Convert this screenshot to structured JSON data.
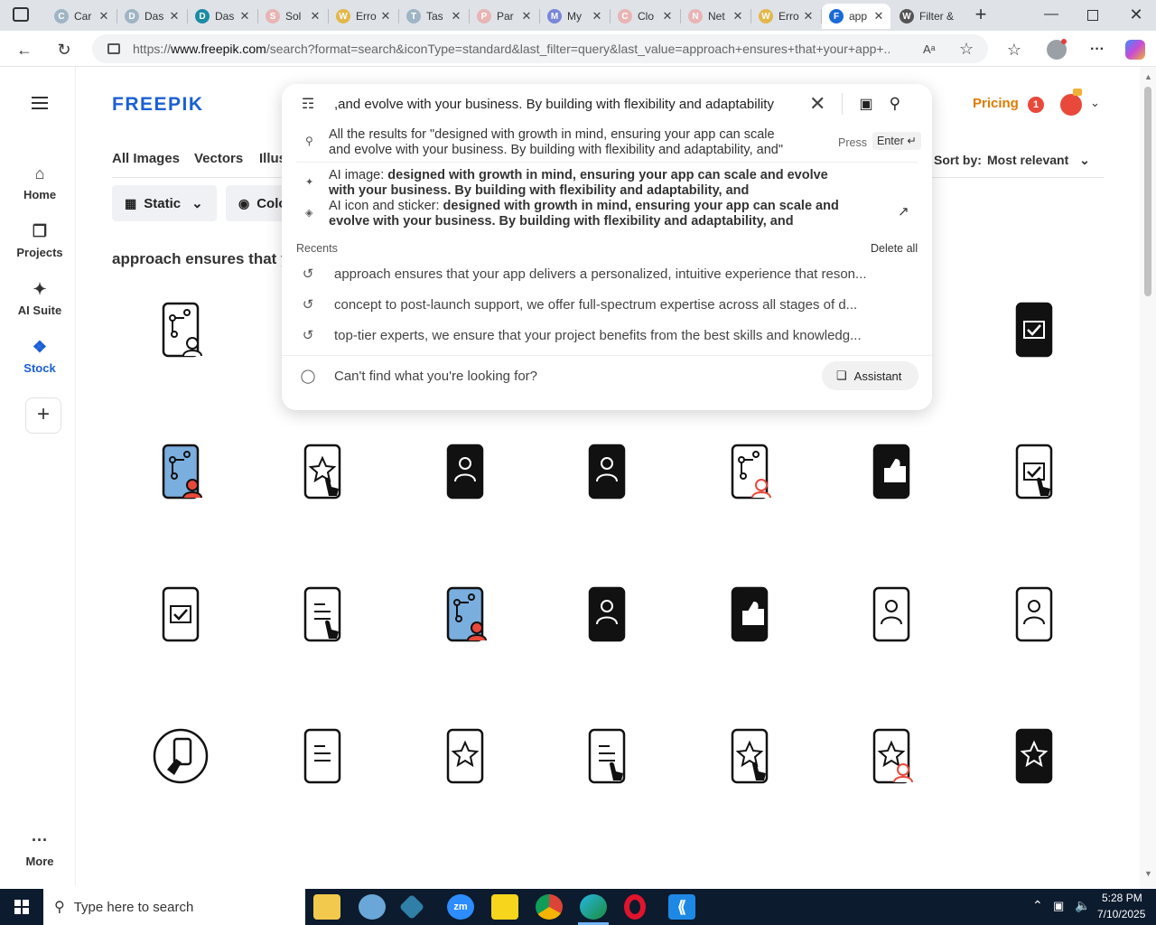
{
  "browser": {
    "tabs": [
      {
        "label": "Car",
        "color": "#9fb4c4",
        "letter": "C"
      },
      {
        "label": "Das",
        "color": "#9fb4c4",
        "letter": "D"
      },
      {
        "label": "Das",
        "color": "#1c8ba6",
        "letter": "D"
      },
      {
        "label": "Sol",
        "color": "#e8b4b4",
        "letter": "S"
      },
      {
        "label": "Erro",
        "color": "#e4b74a",
        "letter": "W"
      },
      {
        "label": "Tas",
        "color": "#9fb4c4",
        "letter": "T"
      },
      {
        "label": "Par",
        "color": "#e8b4b4",
        "letter": "P"
      },
      {
        "label": "My",
        "color": "#7a86d8",
        "letter": "M"
      },
      {
        "label": "Clo",
        "color": "#e8b4b4",
        "letter": "C"
      },
      {
        "label": "Net",
        "color": "#e8b4b4",
        "letter": "N"
      },
      {
        "label": "Erro",
        "color": "#e4b74a",
        "letter": "W"
      },
      {
        "label": "app",
        "color": "#1a6bd8",
        "letter": "F"
      },
      {
        "label": "Filter &",
        "color": "#555555",
        "letter": "W"
      }
    ],
    "url_prefix": "https://",
    "url_domain": "www.freepik.com",
    "url_rest": "/search?format=search&iconType=standard&last_filter=query&last_value=approach+ensures+that+your+app+..."
  },
  "sidebar": {
    "items": [
      {
        "label": "Home",
        "icon": "home-icon"
      },
      {
        "label": "Projects",
        "icon": "projects-icon"
      },
      {
        "label": "AI Suite",
        "icon": "ai-suite-icon"
      },
      {
        "label": "Stock",
        "icon": "stock-icon"
      }
    ],
    "more_label": "More"
  },
  "header": {
    "logo": "FREEPIK",
    "pricing": "Pricing",
    "notification_count": "1"
  },
  "search": {
    "value": "and evolve with your business. By building with flexibility and adaptability,",
    "all_results_line1": "All the results for \"designed with growth in mind, ensuring your app can scale",
    "all_results_line2": "and evolve with your business. By building with flexibility and adaptability, and\"",
    "press": "Press",
    "enter": "Enter ↵",
    "ai_image_prefix": "AI image: ",
    "ai_image_line1": "designed with growth in mind, ensuring your app can scale and evolve",
    "ai_image_line2": "with your business. By building with flexibility and adaptability, and",
    "ai_icon_prefix": "AI icon and sticker: ",
    "ai_icon_line1": "designed with growth in mind, ensuring your app can scale and",
    "ai_icon_line2": "evolve with your business. By building with flexibility and adaptability, and",
    "recents_label": "Recents",
    "delete_all": "Delete all",
    "recents": [
      "approach ensures that your app delivers a personalized, intuitive experience that reson...",
      "concept to post-launch support, we offer full-spectrum expertise across all stages of d...",
      "top-tier experts, we ensure that your project benefits from the best skills and knowledg..."
    ],
    "cant_find": "Can't find what you're looking for?",
    "assistant": "Assistant"
  },
  "categories": [
    "All Images",
    "Vectors",
    "Illus"
  ],
  "sort": {
    "label": "Sort by:",
    "value": "Most relevant"
  },
  "filters": {
    "static": "Static",
    "color": "Colo"
  },
  "results_heading": "approach ensures that y",
  "taskbar": {
    "search_placeholder": "Type here to search",
    "time": "5:28 PM",
    "date": "7/10/2025"
  },
  "colors": {
    "brand": "#1a5fd6",
    "pricing": "#e07b00",
    "accent_red": "#e8493a",
    "icon_blue": "#7aaede"
  }
}
